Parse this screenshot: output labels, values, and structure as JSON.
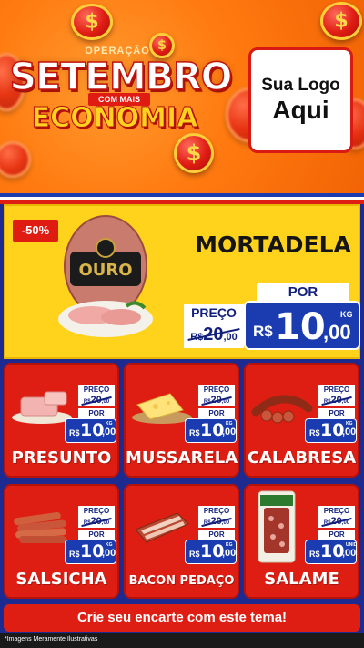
{
  "header": {
    "operacao": "OPERAÇÃO",
    "setembro": "SETEMBRO",
    "com_mais": "COM MAIS",
    "economia": "ECONOMIA",
    "coin_symbol": "$",
    "logo_line1": "Sua Logo",
    "logo_line2": "Aqui"
  },
  "featured": {
    "discount": "-50%",
    "name": "MORTADELA",
    "brand": "OURO",
    "price_label": "PREÇO",
    "old_currency": "R$",
    "old_int": "20",
    "old_dec": ",00",
    "por_label": "POR",
    "currency": "R$",
    "price_int": "10",
    "price_dec": ",00",
    "unit": "KG"
  },
  "products": [
    {
      "name": "PRESUNTO",
      "preco_label": "PREÇO",
      "old_currency": "R$",
      "old_int": "20",
      "old_dec": ",00",
      "por_label": "POR",
      "currency": "R$",
      "price_int": "10",
      "price_dec": ",00",
      "unit": "KG"
    },
    {
      "name": "MUSSARELA",
      "preco_label": "PREÇO",
      "old_currency": "R$",
      "old_int": "20",
      "old_dec": ",00",
      "por_label": "POR",
      "currency": "R$",
      "price_int": "10",
      "price_dec": ",00",
      "unit": "KG"
    },
    {
      "name": "CALABRESA",
      "preco_label": "PREÇO",
      "old_currency": "R$",
      "old_int": "20",
      "old_dec": ",00",
      "por_label": "POR",
      "currency": "R$",
      "price_int": "10",
      "price_dec": ",00",
      "unit": "KG"
    },
    {
      "name": "SALSICHA",
      "preco_label": "PREÇO",
      "old_currency": "R$",
      "old_int": "20",
      "old_dec": ",00",
      "por_label": "POR",
      "currency": "R$",
      "price_int": "10",
      "price_dec": ",00",
      "unit": "KG"
    },
    {
      "name": "BACON PEDAÇO",
      "preco_label": "PREÇO",
      "old_currency": "R$",
      "old_int": "20",
      "old_dec": ",00",
      "por_label": "POR",
      "currency": "R$",
      "price_int": "10",
      "price_dec": ",00",
      "unit": "KG"
    },
    {
      "name": "SALAME",
      "preco_label": "PREÇO",
      "old_currency": "R$",
      "old_int": "20",
      "old_dec": ",00",
      "por_label": "POR",
      "currency": "R$",
      "price_int": "10",
      "price_dec": ",00",
      "unit": "UNID"
    }
  ],
  "cta": "Crie seu encarte com este tema!",
  "footer_note": "*Imagens Meramente Ilustrativas",
  "colors": {
    "brand_red": "#df1e13",
    "brand_blue": "#1a3cb0",
    "accent_yellow": "#ffd21c",
    "header_orange": "#ff7a10"
  }
}
